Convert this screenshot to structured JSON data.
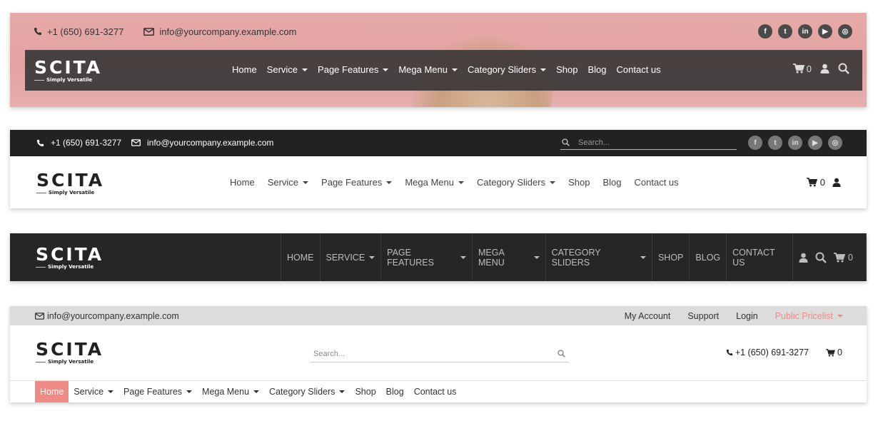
{
  "brand": {
    "name": "SCITA",
    "tagline": "Simply Versatile"
  },
  "contact": {
    "phone": "+1 (650) 691-3277",
    "email": "info@yourcompany.example.com"
  },
  "menu": [
    "Home",
    "Service",
    "Page Features",
    "Mega Menu",
    "Category Sliders",
    "Shop",
    "Blog",
    "Contact us"
  ],
  "menu_upper": [
    "HOME",
    "SERVICE",
    "PAGE FEATURES",
    "MEGA MENU",
    "CATEGORY SLIDERS",
    "SHOP",
    "BLOG",
    "CONTACT US"
  ],
  "dropdown_items": [
    "Service",
    "Page Features",
    "Mega Menu",
    "Category Sliders"
  ],
  "cart_count": "0",
  "search_placeholder": "Search...",
  "socials": [
    "facebook-icon",
    "twitter-icon",
    "linkedin-icon",
    "youtube-icon",
    "instagram-icon"
  ],
  "socials_letters": [
    "f",
    "t",
    "in",
    "▶",
    "◎"
  ],
  "panel4_links": {
    "my_account": "My Account",
    "support": "Support",
    "login": "Login",
    "pricelist": "Public Pricelist"
  },
  "colors": {
    "accent": "#f08a84",
    "dark": "#262626",
    "pink_banner": "#e6aaa9"
  }
}
